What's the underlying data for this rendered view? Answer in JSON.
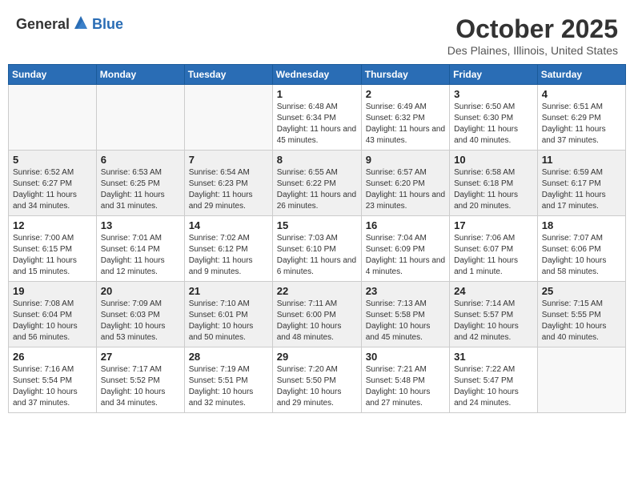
{
  "header": {
    "logo_general": "General",
    "logo_blue": "Blue",
    "month": "October 2025",
    "location": "Des Plaines, Illinois, United States"
  },
  "weekdays": [
    "Sunday",
    "Monday",
    "Tuesday",
    "Wednesday",
    "Thursday",
    "Friday",
    "Saturday"
  ],
  "weeks": [
    [
      {
        "day": "",
        "info": ""
      },
      {
        "day": "",
        "info": ""
      },
      {
        "day": "",
        "info": ""
      },
      {
        "day": "1",
        "info": "Sunrise: 6:48 AM\nSunset: 6:34 PM\nDaylight: 11 hours and 45 minutes."
      },
      {
        "day": "2",
        "info": "Sunrise: 6:49 AM\nSunset: 6:32 PM\nDaylight: 11 hours and 43 minutes."
      },
      {
        "day": "3",
        "info": "Sunrise: 6:50 AM\nSunset: 6:30 PM\nDaylight: 11 hours and 40 minutes."
      },
      {
        "day": "4",
        "info": "Sunrise: 6:51 AM\nSunset: 6:29 PM\nDaylight: 11 hours and 37 minutes."
      }
    ],
    [
      {
        "day": "5",
        "info": "Sunrise: 6:52 AM\nSunset: 6:27 PM\nDaylight: 11 hours and 34 minutes."
      },
      {
        "day": "6",
        "info": "Sunrise: 6:53 AM\nSunset: 6:25 PM\nDaylight: 11 hours and 31 minutes."
      },
      {
        "day": "7",
        "info": "Sunrise: 6:54 AM\nSunset: 6:23 PM\nDaylight: 11 hours and 29 minutes."
      },
      {
        "day": "8",
        "info": "Sunrise: 6:55 AM\nSunset: 6:22 PM\nDaylight: 11 hours and 26 minutes."
      },
      {
        "day": "9",
        "info": "Sunrise: 6:57 AM\nSunset: 6:20 PM\nDaylight: 11 hours and 23 minutes."
      },
      {
        "day": "10",
        "info": "Sunrise: 6:58 AM\nSunset: 6:18 PM\nDaylight: 11 hours and 20 minutes."
      },
      {
        "day": "11",
        "info": "Sunrise: 6:59 AM\nSunset: 6:17 PM\nDaylight: 11 hours and 17 minutes."
      }
    ],
    [
      {
        "day": "12",
        "info": "Sunrise: 7:00 AM\nSunset: 6:15 PM\nDaylight: 11 hours and 15 minutes."
      },
      {
        "day": "13",
        "info": "Sunrise: 7:01 AM\nSunset: 6:14 PM\nDaylight: 11 hours and 12 minutes."
      },
      {
        "day": "14",
        "info": "Sunrise: 7:02 AM\nSunset: 6:12 PM\nDaylight: 11 hours and 9 minutes."
      },
      {
        "day": "15",
        "info": "Sunrise: 7:03 AM\nSunset: 6:10 PM\nDaylight: 11 hours and 6 minutes."
      },
      {
        "day": "16",
        "info": "Sunrise: 7:04 AM\nSunset: 6:09 PM\nDaylight: 11 hours and 4 minutes."
      },
      {
        "day": "17",
        "info": "Sunrise: 7:06 AM\nSunset: 6:07 PM\nDaylight: 11 hours and 1 minute."
      },
      {
        "day": "18",
        "info": "Sunrise: 7:07 AM\nSunset: 6:06 PM\nDaylight: 10 hours and 58 minutes."
      }
    ],
    [
      {
        "day": "19",
        "info": "Sunrise: 7:08 AM\nSunset: 6:04 PM\nDaylight: 10 hours and 56 minutes."
      },
      {
        "day": "20",
        "info": "Sunrise: 7:09 AM\nSunset: 6:03 PM\nDaylight: 10 hours and 53 minutes."
      },
      {
        "day": "21",
        "info": "Sunrise: 7:10 AM\nSunset: 6:01 PM\nDaylight: 10 hours and 50 minutes."
      },
      {
        "day": "22",
        "info": "Sunrise: 7:11 AM\nSunset: 6:00 PM\nDaylight: 10 hours and 48 minutes."
      },
      {
        "day": "23",
        "info": "Sunrise: 7:13 AM\nSunset: 5:58 PM\nDaylight: 10 hours and 45 minutes."
      },
      {
        "day": "24",
        "info": "Sunrise: 7:14 AM\nSunset: 5:57 PM\nDaylight: 10 hours and 42 minutes."
      },
      {
        "day": "25",
        "info": "Sunrise: 7:15 AM\nSunset: 5:55 PM\nDaylight: 10 hours and 40 minutes."
      }
    ],
    [
      {
        "day": "26",
        "info": "Sunrise: 7:16 AM\nSunset: 5:54 PM\nDaylight: 10 hours and 37 minutes."
      },
      {
        "day": "27",
        "info": "Sunrise: 7:17 AM\nSunset: 5:52 PM\nDaylight: 10 hours and 34 minutes."
      },
      {
        "day": "28",
        "info": "Sunrise: 7:19 AM\nSunset: 5:51 PM\nDaylight: 10 hours and 32 minutes."
      },
      {
        "day": "29",
        "info": "Sunrise: 7:20 AM\nSunset: 5:50 PM\nDaylight: 10 hours and 29 minutes."
      },
      {
        "day": "30",
        "info": "Sunrise: 7:21 AM\nSunset: 5:48 PM\nDaylight: 10 hours and 27 minutes."
      },
      {
        "day": "31",
        "info": "Sunrise: 7:22 AM\nSunset: 5:47 PM\nDaylight: 10 hours and 24 minutes."
      },
      {
        "day": "",
        "info": ""
      }
    ]
  ]
}
